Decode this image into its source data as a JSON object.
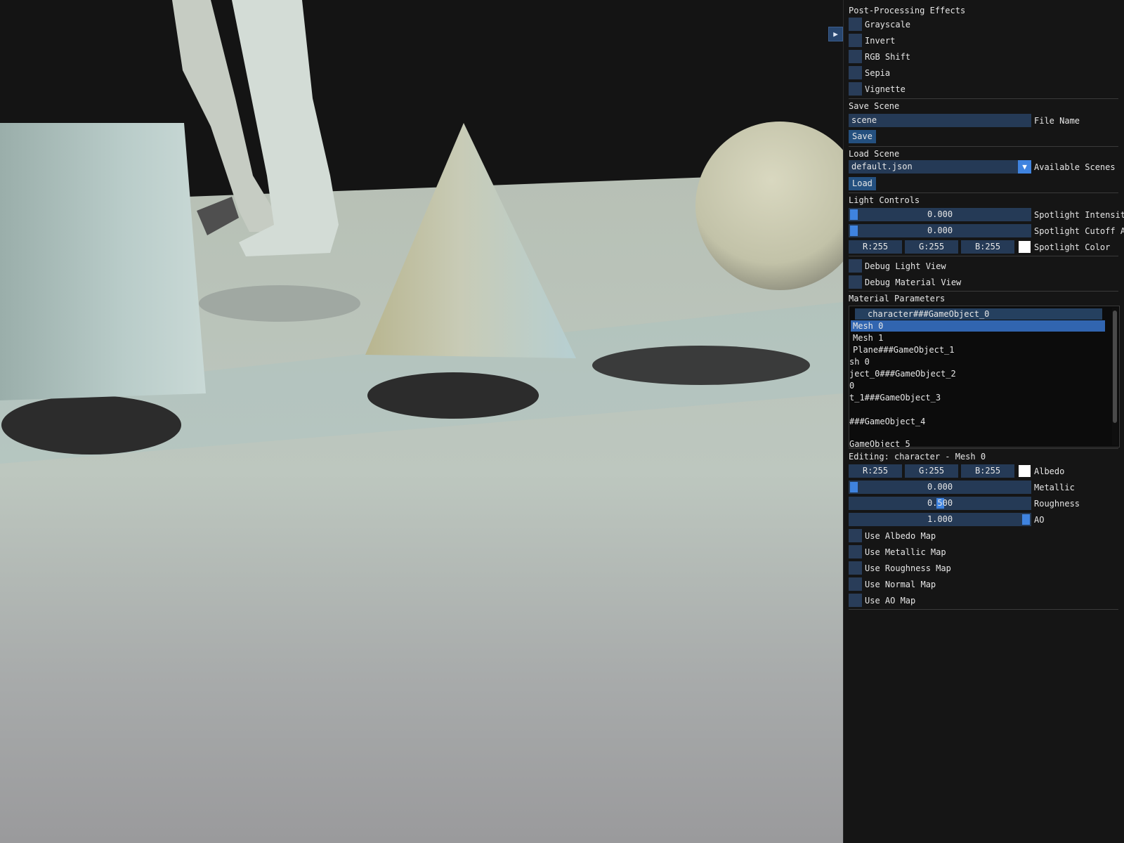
{
  "viewport": {
    "label": "3D scene viewport"
  },
  "collapse_button": {
    "glyph": "▶"
  },
  "post_processing": {
    "header": "Post-Processing Effects",
    "effects": [
      "Grayscale",
      "Invert",
      "RGB Shift",
      "Sepia",
      "Vignette"
    ]
  },
  "save_scene": {
    "header": "Save Scene",
    "file_name_value": "scene",
    "file_name_label": "File Name",
    "save_label": "Save"
  },
  "load_scene": {
    "header": "Load Scene",
    "selected": "default.json",
    "dropdown_label": "Available Scenes",
    "load_label": "Load"
  },
  "light_controls": {
    "header": "Light Controls",
    "intensity_value": "0.000",
    "intensity_label": "Spotlight Intensity",
    "cutoff_value": "0.000",
    "cutoff_label": "Spotlight Cutoff Angle",
    "color_r": "R:255",
    "color_g": "G:255",
    "color_b": "B:255",
    "color_label": "Spotlight Color",
    "debug_light": "Debug Light View",
    "debug_material": "Debug Material View"
  },
  "material_parameters": {
    "header": "Material Parameters",
    "tree_items": [
      "character###GameObject_0",
      "Mesh 0",
      "Mesh 1",
      "Plane###GameObject_1",
      "sh 0",
      "ject_0###GameObject_2",
      "0",
      "t_1###GameObject_3",
      "###GameObject_4",
      "GameObject_5"
    ]
  },
  "editing": {
    "title": "Editing: character - Mesh 0",
    "albedo_r": "R:255",
    "albedo_g": "G:255",
    "albedo_b": "B:255",
    "albedo_label": "Albedo",
    "metallic_value": "0.000",
    "metallic_label": "Metallic",
    "metallic_level": 0.0,
    "roughness_value": "0.500",
    "roughness_label": "Roughness",
    "roughness_level": 0.5,
    "ao_value": "1.000",
    "ao_label": "AO",
    "ao_level": 1.0,
    "maps": [
      "Use Albedo Map",
      "Use Metallic Map",
      "Use Roughness Map",
      "Use Normal Map",
      "Use AO Map"
    ]
  },
  "colors": {
    "panel_bg": "#151515",
    "frame_bg": "#253a56",
    "accent": "#3f83df",
    "button": "#24507f",
    "selected_row": "#3165b0"
  }
}
